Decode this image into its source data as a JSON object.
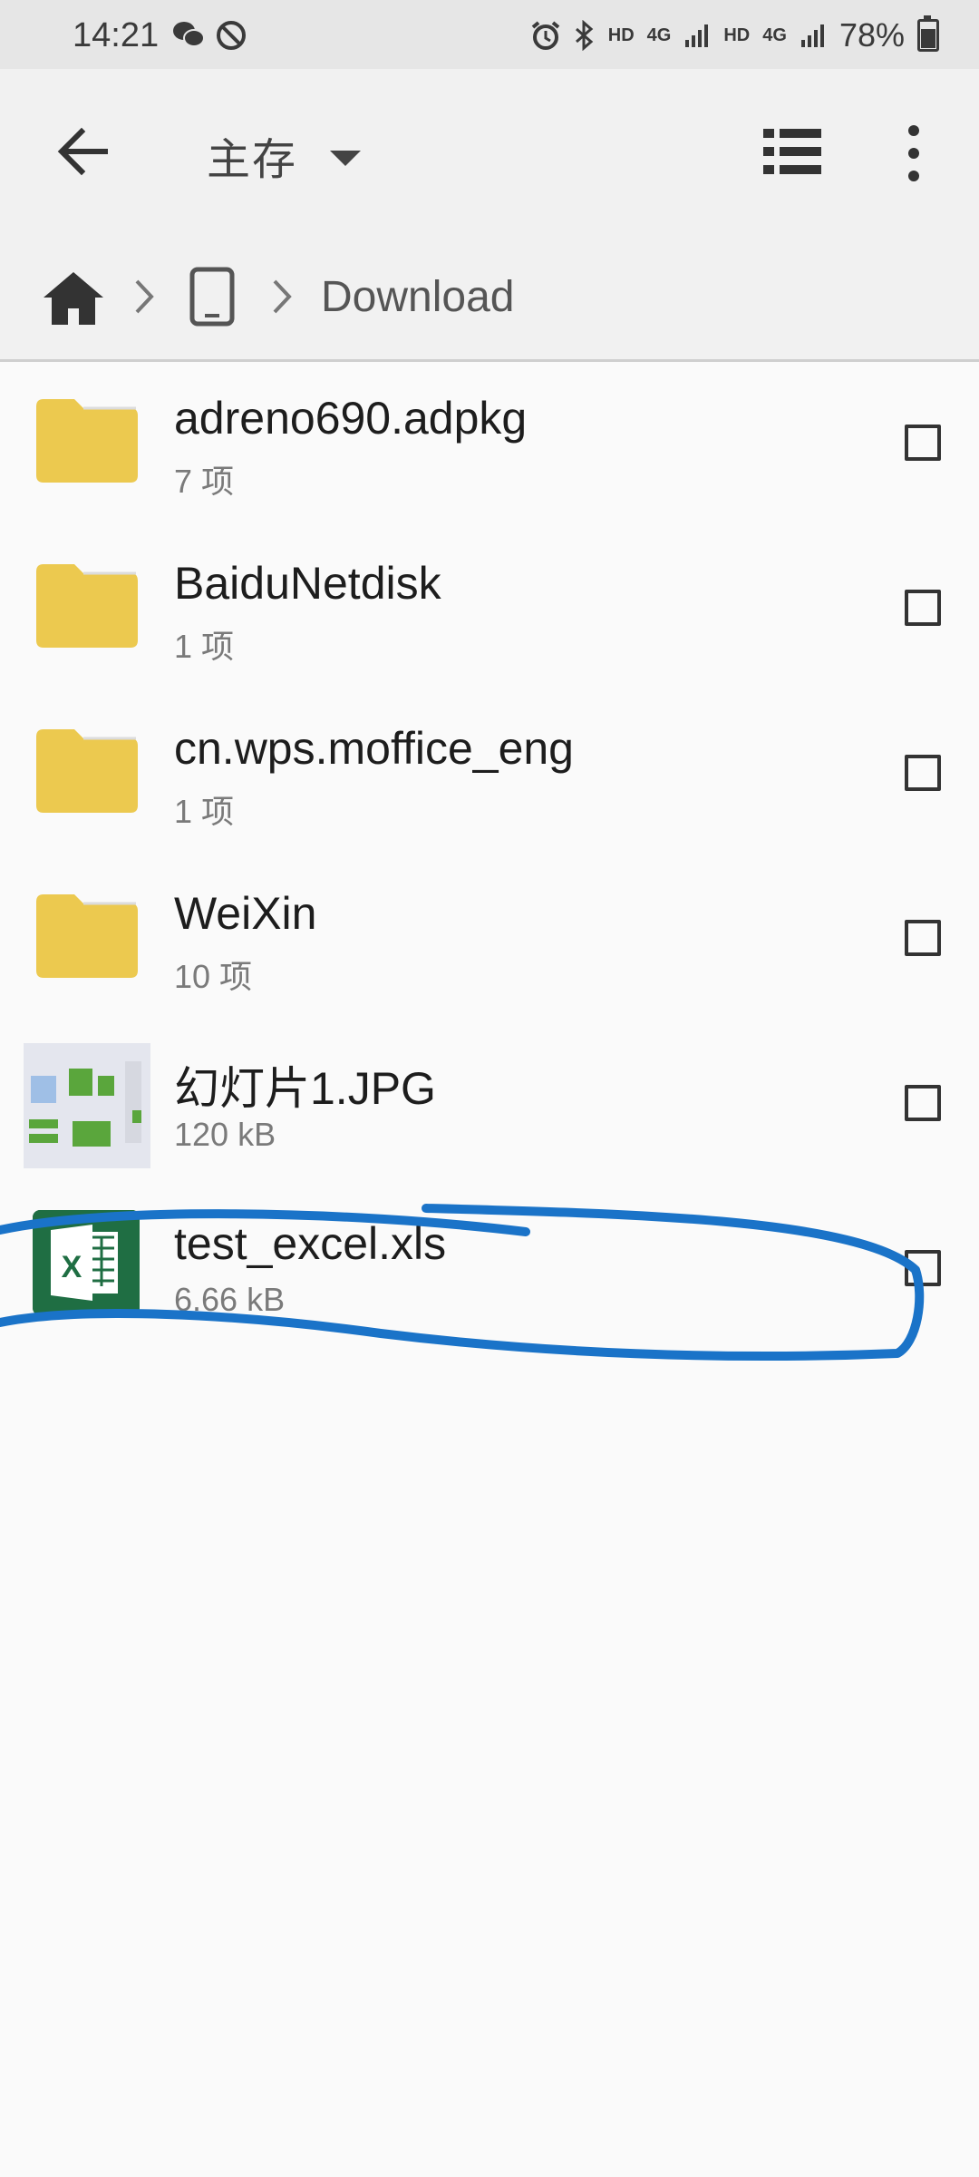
{
  "status_bar": {
    "time": "14:21",
    "battery": "78%",
    "icons": [
      "wechat-icon",
      "blocked-icon",
      "alarm-icon",
      "bluetooth-icon",
      "hd-icon",
      "4g-icon",
      "signal-icon",
      "hd-icon",
      "4g-icon",
      "signal-icon",
      "battery-icon"
    ],
    "hd_label": "HD",
    "net_label": "4G"
  },
  "app_bar": {
    "title": "主存",
    "icons": [
      "back-arrow-icon",
      "dropdown-caret-icon",
      "list-view-icon",
      "more-vert-icon"
    ]
  },
  "breadcrumb": {
    "icons": [
      "home-icon",
      "chevron-right-icon",
      "phone-icon",
      "chevron-right-icon"
    ],
    "current": "Download"
  },
  "files": [
    {
      "name": "adreno690.adpkg",
      "meta": "7 项",
      "type": "folder"
    },
    {
      "name": "BaiduNetdisk",
      "meta": "1 项",
      "type": "folder"
    },
    {
      "name": "cn.wps.moffice_eng",
      "meta": "1 项",
      "type": "folder"
    },
    {
      "name": "WeiXin",
      "meta": "10 项",
      "type": "folder"
    },
    {
      "name": "幻灯片1.JPG",
      "meta": "120 kB",
      "type": "image"
    },
    {
      "name": "test_excel.xls",
      "meta": "6.66 kB",
      "type": "excel"
    }
  ],
  "colors": {
    "folder": "#ECC94F",
    "excel": "#1F6E43",
    "annotation": "#1A73C8"
  }
}
